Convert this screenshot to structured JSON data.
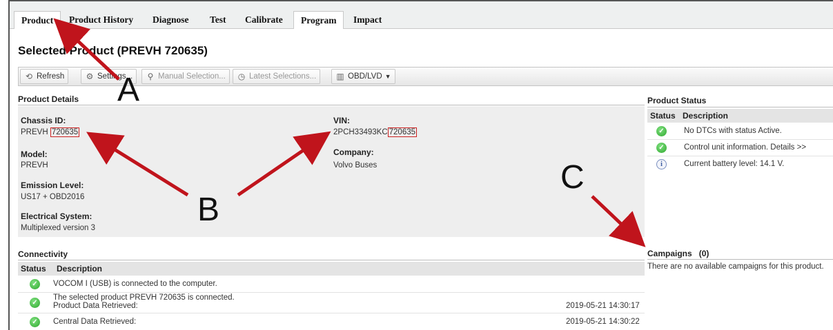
{
  "tabs": [
    "Product",
    "Product History",
    "Diagnose",
    "Test",
    "Calibrate",
    "Program",
    "Impact"
  ],
  "page_title": "Selected Product (PREVH 720635)",
  "toolbar": {
    "refresh": "Refresh",
    "settings": "Settings...",
    "manual_selection": "Manual Selection...",
    "latest_selections": "Latest Selections...",
    "obd": "OBD/LVD"
  },
  "product_details": {
    "heading": "Product Details",
    "chassis_id_label": "Chassis ID:",
    "chassis_id_prefix": "PREVH",
    "chassis_id_number": "720635",
    "vin_label": "VIN:",
    "vin_prefix": "2PCH33493KC",
    "vin_suffix": "720635",
    "model_label": "Model:",
    "model_value": "PREVH",
    "company_label": "Company:",
    "company_value": "Volvo Buses",
    "emission_label": "Emission Level:",
    "emission_value": "US17 + OBD2016",
    "electrical_label": "Electrical System:",
    "electrical_value": "Multiplexed version 3"
  },
  "product_status": {
    "heading": "Product Status",
    "col_status": "Status",
    "col_description": "Description",
    "rows": [
      {
        "icon": "check-icon",
        "text": "No DTCs with status Active."
      },
      {
        "icon": "check-icon",
        "text": "Control unit information. Details >>"
      },
      {
        "icon": "info-icon",
        "text": "Current battery level: 14.1 V."
      }
    ]
  },
  "campaigns": {
    "heading": "Campaigns",
    "count": "(0)",
    "message": "There are no available campaigns for this product."
  },
  "connectivity": {
    "heading": "Connectivity",
    "col_status": "Status",
    "col_description": "Description",
    "rows": [
      {
        "icon": "check-icon",
        "text": "VOCOM I (USB) is connected to the computer.",
        "text2": "",
        "time": ""
      },
      {
        "icon": "check-icon",
        "text": "The selected product PREVH 720635 is connected.",
        "text2": "Product Data Retrieved:",
        "time": "2019-05-21 14:30:17"
      },
      {
        "icon": "check-icon",
        "text": "Central Data Retrieved:",
        "text2": "",
        "time": "2019-05-21 14:30:22"
      }
    ]
  },
  "annotations": {
    "a": "A",
    "b": "B",
    "c": "C",
    "arrow_color": "#c0141c"
  }
}
